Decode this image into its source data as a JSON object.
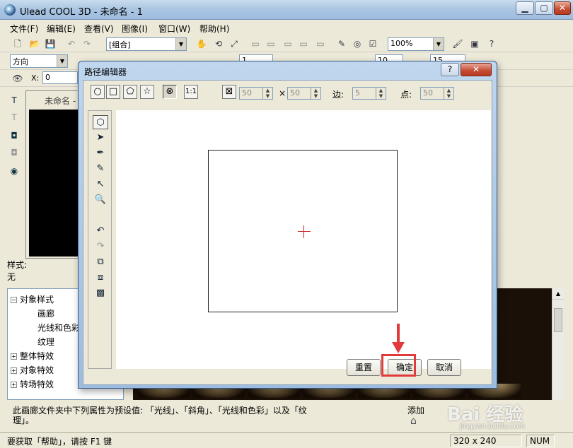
{
  "window": {
    "title": "Ulead COOL 3D - 未命名 - 1"
  },
  "menu": [
    "文件(F)",
    "编辑(E)",
    "查看(V)",
    "图像(I)",
    "窗口(W)",
    "帮助(H)"
  ],
  "toolbar": {
    "group_combo": "[组合]",
    "zoom_combo": "100%"
  },
  "toolbar2": {
    "direction_combo": "方向",
    "field_1": "1",
    "field_10": "10",
    "field_15": "15"
  },
  "toolbar3": {
    "x_label": "X:",
    "x_value": "0"
  },
  "document": {
    "tab_title": "未命名 -"
  },
  "style": {
    "label": "样式:",
    "value": "无"
  },
  "tree": {
    "items": [
      {
        "label": "对象样式",
        "expander": "−"
      },
      {
        "label": "画廊",
        "expander": ""
      },
      {
        "label": "光线和色彩",
        "expander": ""
      },
      {
        "label": "纹理",
        "expander": ""
      },
      {
        "label": "整体特效",
        "expander": "+"
      },
      {
        "label": "对象特效",
        "expander": "+"
      },
      {
        "label": "转场特效",
        "expander": "+"
      }
    ]
  },
  "description": {
    "line1": "此画廊文件夹中下列属性为预设值: 「光线」、「斜角」、「光线和色彩」以及「纹",
    "line2": "理」。"
  },
  "add_label": "添加",
  "status": {
    "help": "要获取「帮助」，请按 F1 键",
    "size": "320 x 240",
    "num": "NUM"
  },
  "dialog": {
    "title": "路径编辑器",
    "width_value": "50",
    "times": "×",
    "height_value": "50",
    "sides_label": "边:",
    "sides_value": "5",
    "points_label": "点:",
    "points_value": "50",
    "reset_button": "重置",
    "ok_button": "确定",
    "cancel_button": "取消",
    "help_button": "?",
    "close_button": "✕"
  },
  "watermark": {
    "text": "Bai  经验",
    "sub": "jingyan.baidu.com"
  },
  "colors": {
    "highlight": "#e23a3a",
    "dialog_title_bg": "#bfd6ee",
    "cross": "#cc2222"
  }
}
